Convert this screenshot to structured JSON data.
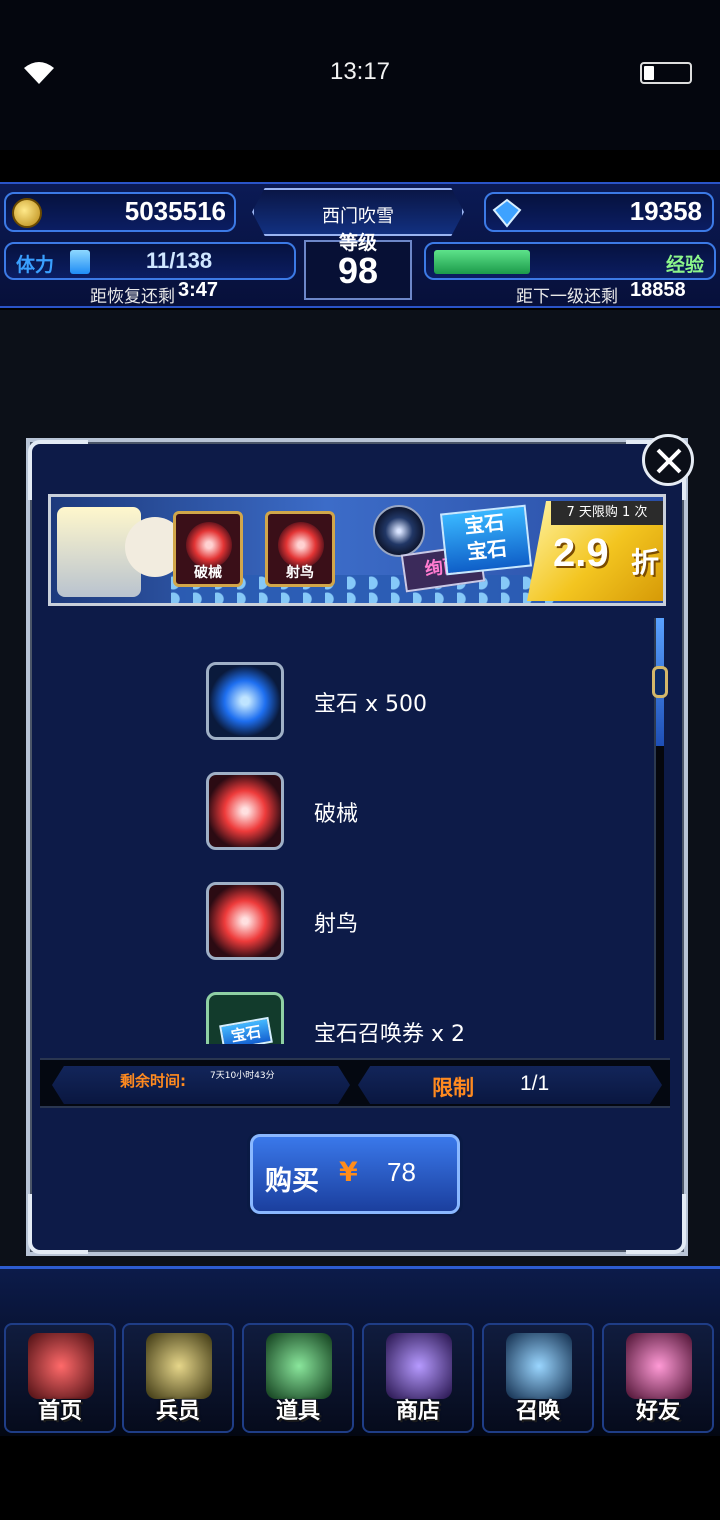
{
  "status_bar": {
    "time": "13:17"
  },
  "hud": {
    "coins": "5035516",
    "gems": "19358",
    "player_name": "西门吹雪",
    "level_label": "等级",
    "level": "98",
    "stamina_label": "体力",
    "stamina": "11/138",
    "recover_label": "距恢复还剩",
    "recover_time": "3:47",
    "exp_label": "经验",
    "next_level_label": "距下一级还剩",
    "next_level_exp": "18858"
  },
  "banner": {
    "card1_label": "破械",
    "card2_label": "射鸟",
    "ticket_label": "绚丽",
    "gem_tag_label": "宝石",
    "limit_tag": "7 天限购 1 次",
    "discount_value": "2.9",
    "discount_unit": "折"
  },
  "items": [
    {
      "name": "宝石 x 500",
      "icon": "gem-icon"
    },
    {
      "name": "破械",
      "icon": "skill-icon"
    },
    {
      "name": "射鸟",
      "icon": "skill-icon"
    },
    {
      "name": "宝石召唤券 x 2",
      "icon": "ticket-icon",
      "icon_text": "宝石"
    }
  ],
  "info": {
    "time_label": "剩余时间:",
    "time_value": "7天10小时43分",
    "limit_label": "限制",
    "limit_value": "1/1"
  },
  "buy": {
    "label": "购买",
    "currency": "¥",
    "price": "78"
  },
  "nav": [
    {
      "label": "首页",
      "color": "#c23a3a"
    },
    {
      "label": "兵员",
      "color": "#9c8c3a"
    },
    {
      "label": "道具",
      "color": "#3a8c4a"
    },
    {
      "label": "商店",
      "color": "#6a4ab0"
    },
    {
      "label": "召唤",
      "color": "#3a7ca8"
    },
    {
      "label": "好友",
      "color": "#b03a7a"
    }
  ]
}
